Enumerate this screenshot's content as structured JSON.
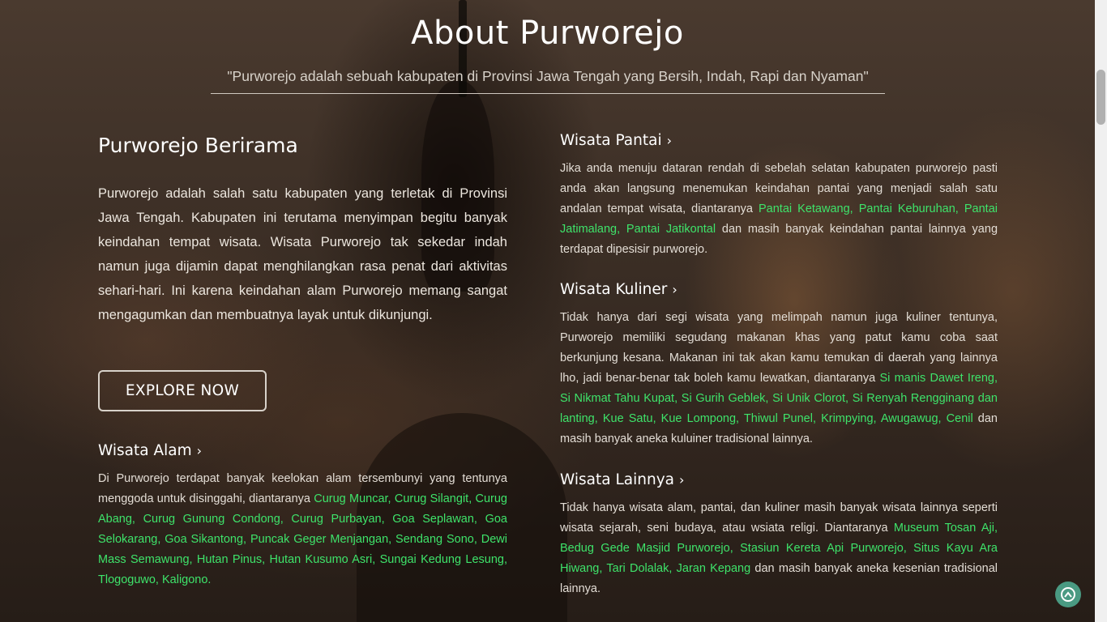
{
  "header": {
    "title": "About Purworejo",
    "subtitle": "\"Purworejo adalah sebuah kabupaten di Provinsi Jawa Tengah yang Bersih, Indah, Rapi dan Nyaman\""
  },
  "intro": {
    "heading": "Purworejo Berirama",
    "text": "Purworejo adalah salah satu kabupaten yang terletak di Provinsi Jawa Tengah. Kabupaten ini terutama menyimpan begitu banyak keindahan tempat wisata. Wisata Purworejo tak sekedar indah namun juga dijamin dapat menghilangkan rasa penat dari aktivitas sehari-hari. Ini karena keindahan alam Purworejo memang sangat mengagumkan dan membuatnya layak untuk dikunjungi.",
    "button": "EXPLORE NOW"
  },
  "sections": {
    "alam": {
      "heading": "Wisata Alam",
      "text_before": "Di Purworejo terdapat banyak keelokan alam tersembunyi yang tentunya menggoda untuk disinggahi, diantaranya ",
      "highlight": "Curug Muncar, Curug Silangit, Curug Abang, Curug Gunung Condong, Curug Purbayan, Goa Seplawan, Goa Selokarang, Goa Sikantong, Puncak Geger Menjangan, Sendang Sono, Dewi Mass Semawung, Hutan Pinus, Hutan Kusumo Asri, Sungai Kedung Lesung, Tlogoguwo, Kaligono.",
      "text_after": ""
    },
    "pantai": {
      "heading": "Wisata Pantai",
      "text_before": "Jika anda menuju dataran rendah di sebelah selatan kabupaten purworejo pasti anda akan langsung menemukan keindahan pantai yang menjadi salah satu andalan tempat wisata, diantaranya ",
      "highlight": "Pantai Ketawang, Pantai Keburuhan, Pantai Jatimalang, Pantai Jatikontal",
      "text_after": " dan masih banyak keindahan pantai lainnya yang terdapat dipesisir purworejo."
    },
    "kuliner": {
      "heading": "Wisata Kuliner",
      "text_before": "Tidak hanya dari segi wisata yang melimpah namun juga kuliner tentunya, Purworejo memiliki segudang makanan khas yang patut kamu coba saat berkunjung kesana. Makanan ini tak akan kamu temukan di daerah yang lainnya lho, jadi benar-benar tak boleh kamu lewatkan, diantaranya ",
      "highlight": "Si manis Dawet Ireng, Si Nikmat Tahu Kupat, Si Gurih Geblek, Si Unik Clorot, Si Renyah Rengginang dan lanting, Kue Satu, Kue Lompong, Thiwul Punel, Krimpying, Awugawug, Cenil",
      "text_after": " dan masih banyak aneka kuluiner tradisional lainnya."
    },
    "lainnya": {
      "heading": "Wisata Lainnya",
      "text_before": "Tidak hanya wisata alam, pantai, dan kuliner masih banyak wisata lainnya seperti wisata sejarah, seni budaya, atau wsiata religi. Diantaranya ",
      "highlight": "Museum Tosan Aji, Bedug Gede Masjid Purworejo, Stasiun Kereta Api Purworejo, Situs Kayu Ara Hiwang, Tari Dolalak, Jaran Kepang",
      "text_after": " dan masih banyak aneka kesenian tradisional lainnya."
    }
  },
  "icons": {
    "chevron": "chevron-right-icon",
    "back_to_top": "arrow-up-icon"
  },
  "colors": {
    "highlight": "#3ee36a",
    "back_to_top_bg": "#4a9a82"
  }
}
